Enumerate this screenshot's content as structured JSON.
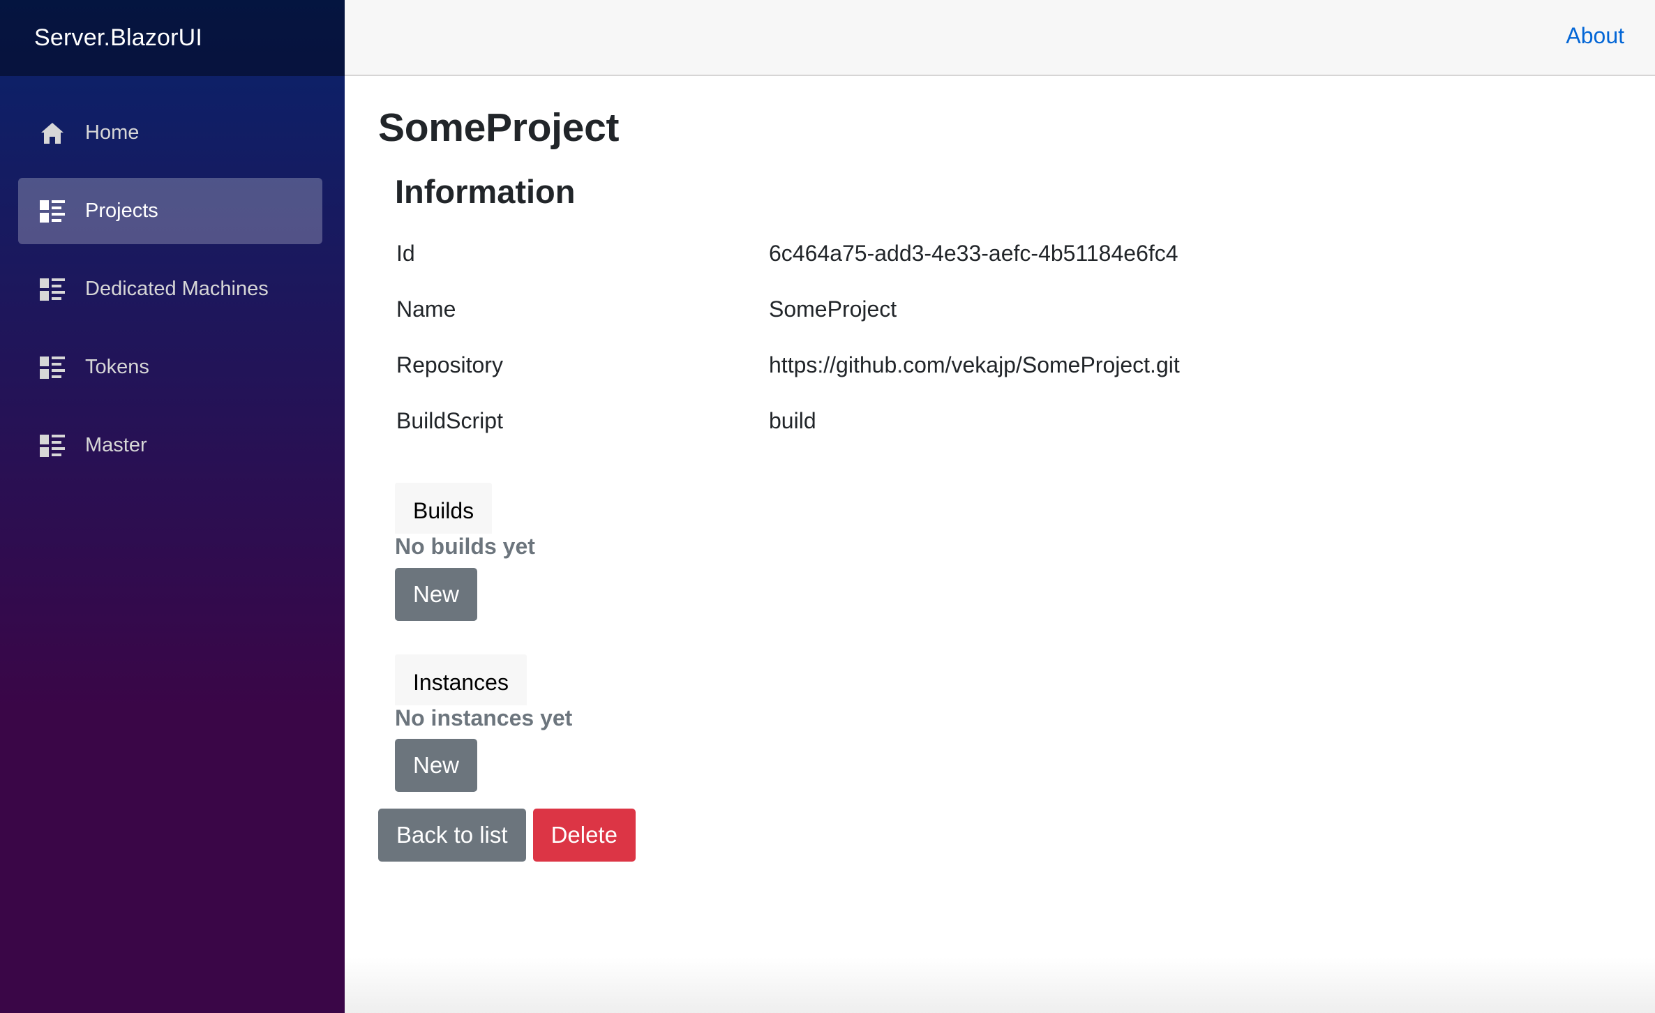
{
  "sidebar": {
    "brand": "Server.BlazorUI",
    "items": [
      {
        "label": "Home",
        "icon": "home-icon",
        "active": false
      },
      {
        "label": "Projects",
        "icon": "list-icon",
        "active": true
      },
      {
        "label": "Dedicated Machines",
        "icon": "list-icon",
        "active": false
      },
      {
        "label": "Tokens",
        "icon": "list-icon",
        "active": false
      },
      {
        "label": "Master",
        "icon": "list-icon",
        "active": false
      }
    ]
  },
  "topbar": {
    "about_label": "About"
  },
  "main": {
    "title": "SomeProject",
    "information": {
      "heading": "Information",
      "rows": [
        {
          "key": "Id",
          "value": "6c464a75-add3-4e33-aefc-4b51184e6fc4"
        },
        {
          "key": "Name",
          "value": "SomeProject"
        },
        {
          "key": "Repository",
          "value": "https://github.com/vekajp/SomeProject.git"
        },
        {
          "key": "BuildScript",
          "value": "build"
        }
      ]
    },
    "builds": {
      "tab_label": "Builds",
      "empty_text": "No builds yet",
      "new_label": "New"
    },
    "instances": {
      "tab_label": "Instances",
      "empty_text": "No instances yet",
      "new_label": "New"
    },
    "actions": {
      "back_label": "Back to list",
      "delete_label": "Delete"
    }
  },
  "colors": {
    "sidebar_top": "#08236b",
    "sidebar_bottom": "#3a0647",
    "link": "#0366d6",
    "secondary": "#6c757d",
    "danger": "#dc3545"
  }
}
